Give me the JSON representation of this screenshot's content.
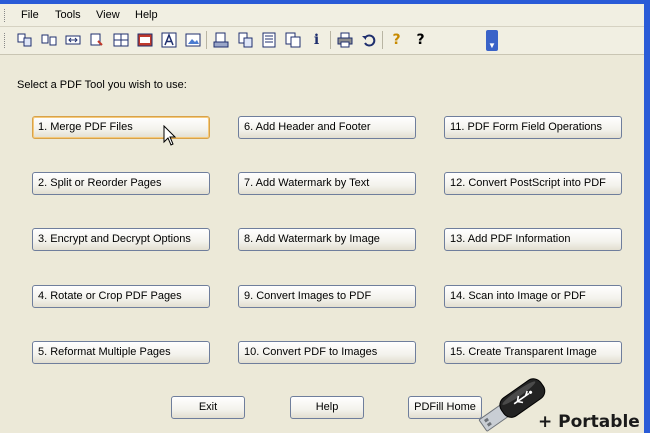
{
  "menu": [
    "File",
    "Tools",
    "View",
    "Help"
  ],
  "toolbar": {
    "buttons": [
      "merge-icon",
      "split-icon",
      "crop-icon",
      "convert-icon",
      "grid-icon",
      "film-icon",
      "text-a-icon",
      "image-icon",
      "scan-icon",
      "reformat-icon",
      "document-icon",
      "pages-icon",
      "info-icon",
      "printer-icon",
      "undo-icon",
      "help-icon",
      "whats-this-icon"
    ],
    "info_glyph": "i",
    "help_glyph": "?",
    "whats_this_glyph": "?"
  },
  "prompt": "Select a PDF Tool you wish to use:",
  "tools": [
    "1. Merge PDF Files",
    "2. Split or Reorder Pages",
    "3. Encrypt and Decrypt Options",
    "4. Rotate or Crop PDF Pages",
    "5. Reformat Multiple Pages",
    "6. Add Header and Footer",
    "7. Add Watermark by Text",
    "8. Add Watermark by Image",
    "9. Convert Images to PDF",
    "10. Convert PDF to Images",
    "11. PDF Form Field Operations",
    "12. Convert PostScript into PDF",
    "13. Add PDF Information",
    "14. Scan into Image or PDF",
    "15. Create Transparent Image"
  ],
  "footer": {
    "exit": "Exit",
    "help": "Help",
    "home": "PDFill Home"
  },
  "overlay": {
    "portable": "+ Portable"
  },
  "colors": {
    "window_bg": "#ece9d8",
    "titlebar": "#2a5bd7",
    "focus": "#d8a24a"
  }
}
